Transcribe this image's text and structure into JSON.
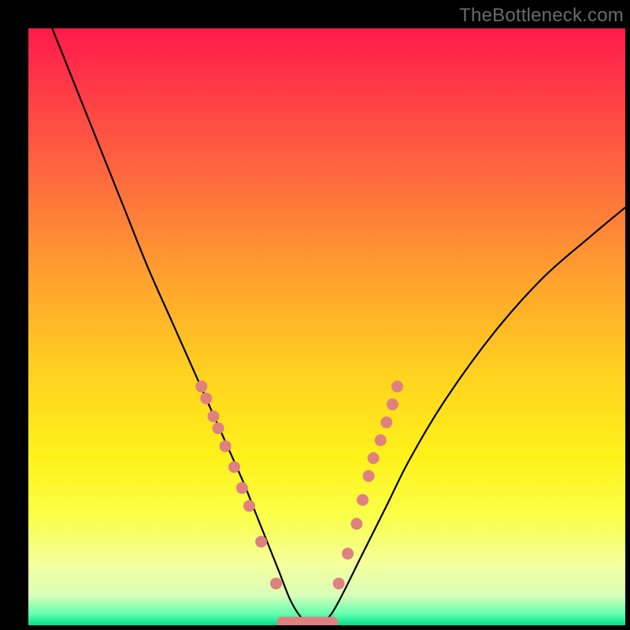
{
  "watermark": {
    "text": "TheBottleneck.com"
  },
  "chart_data": {
    "type": "line",
    "title": "",
    "xlabel": "",
    "ylabel": "",
    "xlim": [
      0,
      100
    ],
    "ylim": [
      0,
      100
    ],
    "grid": false,
    "legend": false,
    "series": [
      {
        "name": "curve",
        "comment": "Black V-shaped curve. Values are approximate y% at each x% (percent of plot width/height).",
        "x": [
          4,
          8,
          12,
          16,
          20,
          24,
          28,
          32,
          36,
          38,
          40,
          42,
          44,
          46,
          48,
          50,
          52,
          56,
          60,
          64,
          70,
          78,
          86,
          94,
          100
        ],
        "y": [
          100,
          90,
          80,
          70,
          60,
          51,
          42,
          33,
          24,
          19,
          14,
          9,
          4,
          1,
          0,
          1,
          4,
          12,
          20,
          28,
          38,
          49,
          58,
          65,
          70
        ]
      },
      {
        "name": "markers-left",
        "comment": "Salmon dots along left slope near the valley.",
        "x": [
          29.0,
          29.8,
          31.0,
          31.8,
          33.0,
          34.5,
          35.8,
          37.0,
          39.0,
          41.5
        ],
        "y": [
          40.0,
          38.0,
          35.0,
          33.0,
          30.0,
          26.5,
          23.0,
          20.0,
          14.0,
          7.0
        ]
      },
      {
        "name": "markers-right",
        "comment": "Salmon dots along right slope near the valley.",
        "x": [
          52.0,
          53.5,
          55.0,
          56.0,
          57.0,
          57.8,
          59.0,
          60.0,
          61.0,
          61.8
        ],
        "y": [
          7.0,
          12.0,
          17.0,
          21.0,
          25.0,
          28.0,
          31.0,
          34.0,
          37.0,
          40.0
        ]
      },
      {
        "name": "valley-band",
        "comment": "Thick salmon segment at the bottom of the V between the slopes.",
        "x": [
          42.5,
          51.0
        ],
        "y": [
          0.5,
          0.5
        ]
      }
    ],
    "colors": {
      "curve": "#000000",
      "markers": "#e08080",
      "valley_band": "#e08080"
    }
  }
}
